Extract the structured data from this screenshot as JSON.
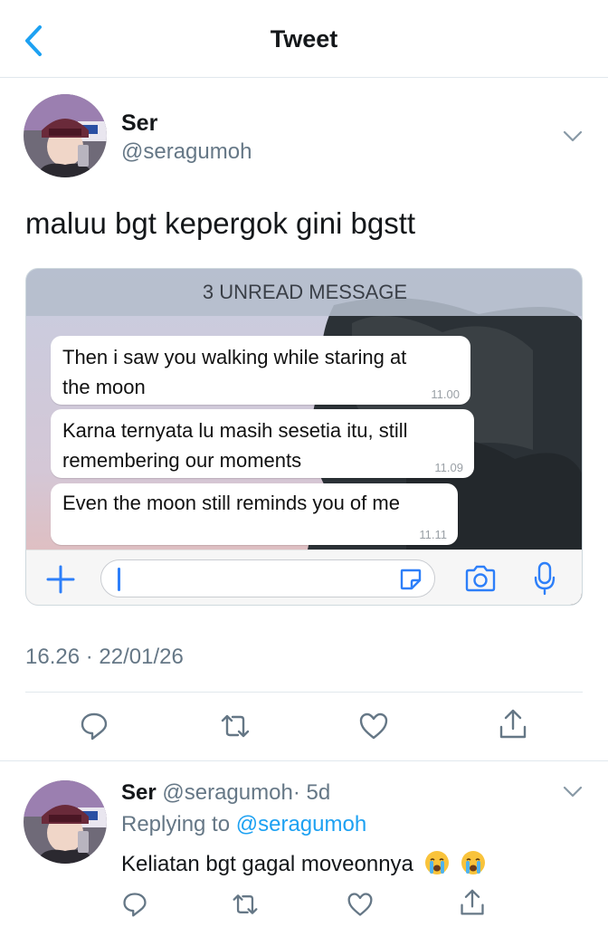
{
  "header": {
    "title": "Tweet",
    "back_icon": "chevron-left-icon"
  },
  "colors": {
    "accent": "#1da1f2",
    "secondary_text": "#657786",
    "divider": "#e1e8ed"
  },
  "tweet": {
    "author_name": "Ser",
    "author_handle": "@seragumoh",
    "text": "maluu bgt kepergok gini bgstt",
    "timestamp": "16.26 · 22/01/26"
  },
  "media": {
    "unread_banner": "3 UNREAD MESSAGE",
    "messages": [
      {
        "text": "Then i saw you walking while staring at\nthe moon",
        "time": "11.00"
      },
      {
        "text": "Karna ternyata lu masih sesetia itu, still\nremembering our moments",
        "time": "11.09"
      },
      {
        "text": "Even the moon still reminds you of me",
        "time": "11.11"
      }
    ],
    "input_icons": [
      "plus-icon",
      "sticker-icon",
      "camera-icon",
      "microphone-icon"
    ]
  },
  "actions": [
    "reply-icon",
    "retweet-icon",
    "like-icon",
    "share-icon"
  ],
  "reply": {
    "author_name": "Ser",
    "author_handle": "@seragumoh",
    "age": "· 5d",
    "replying_prefix": "Replying to",
    "replying_handle": "@seragumoh",
    "text": "Keliatan bgt gagal moveonnya",
    "emoji": "crying-face-emoji"
  }
}
